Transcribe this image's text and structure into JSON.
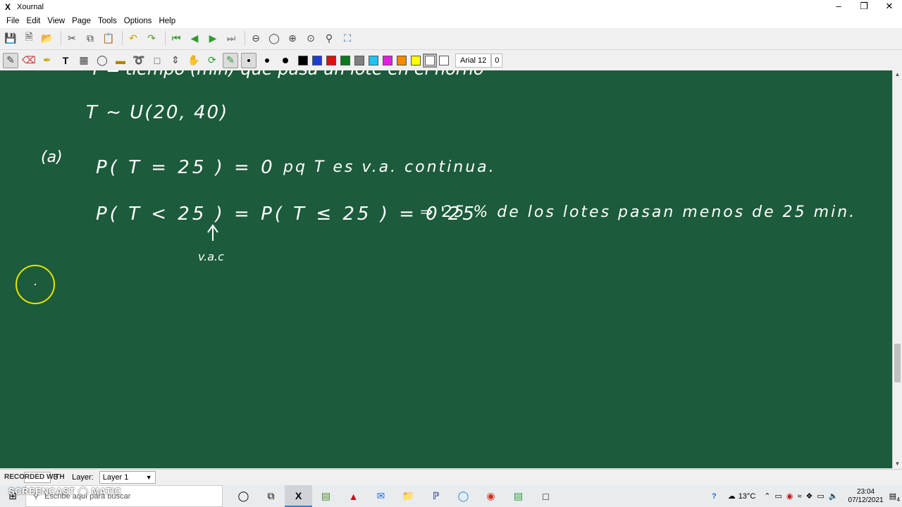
{
  "window": {
    "title": "Xournal",
    "app_icon": "X"
  },
  "menu": [
    "File",
    "Edit",
    "View",
    "Page",
    "Tools",
    "Options",
    "Help"
  ],
  "toolbar2": {
    "font_label": "Arial 12",
    "font_size_field": "0",
    "colors": [
      "#000000",
      "#1b3fc9",
      "#e01010",
      "#0a7a1c",
      "#808080",
      "#1ec3f0",
      "#e020e0",
      "#f08a00",
      "#ffff00",
      "#ffffff",
      "#ffffff"
    ]
  },
  "canvas": {
    "bg_color": "#1c5b3b",
    "lines": {
      "partial_top": "T = tiempo (min) que pasa un lote en el horno",
      "distribution": "T ∼ U(20, 40)",
      "part_label": "(a)",
      "eq1": "P( T = 25 ) = 0",
      "eq1_note": "pq T es v.a. continua.",
      "eq2": "P( T < 25 ) = P( T ≤ 25 ) = 0'25",
      "eq2_note": "⇒ 25 % de los lotes pasan menos de 25 min.",
      "annotation": "v.a.c"
    }
  },
  "statusbar": {
    "page_of": "3",
    "layer_label": "Layer:",
    "layer_value": "Layer 1",
    "watermark": "RECORDED WITH"
  },
  "taskbar": {
    "brand": "SCREENCAST ◯ MATIC",
    "search_placeholder": "Escribe aquí para buscar",
    "temperature": "13°C",
    "time": "23:04",
    "date": "07/12/2021",
    "notification_count": "4"
  }
}
